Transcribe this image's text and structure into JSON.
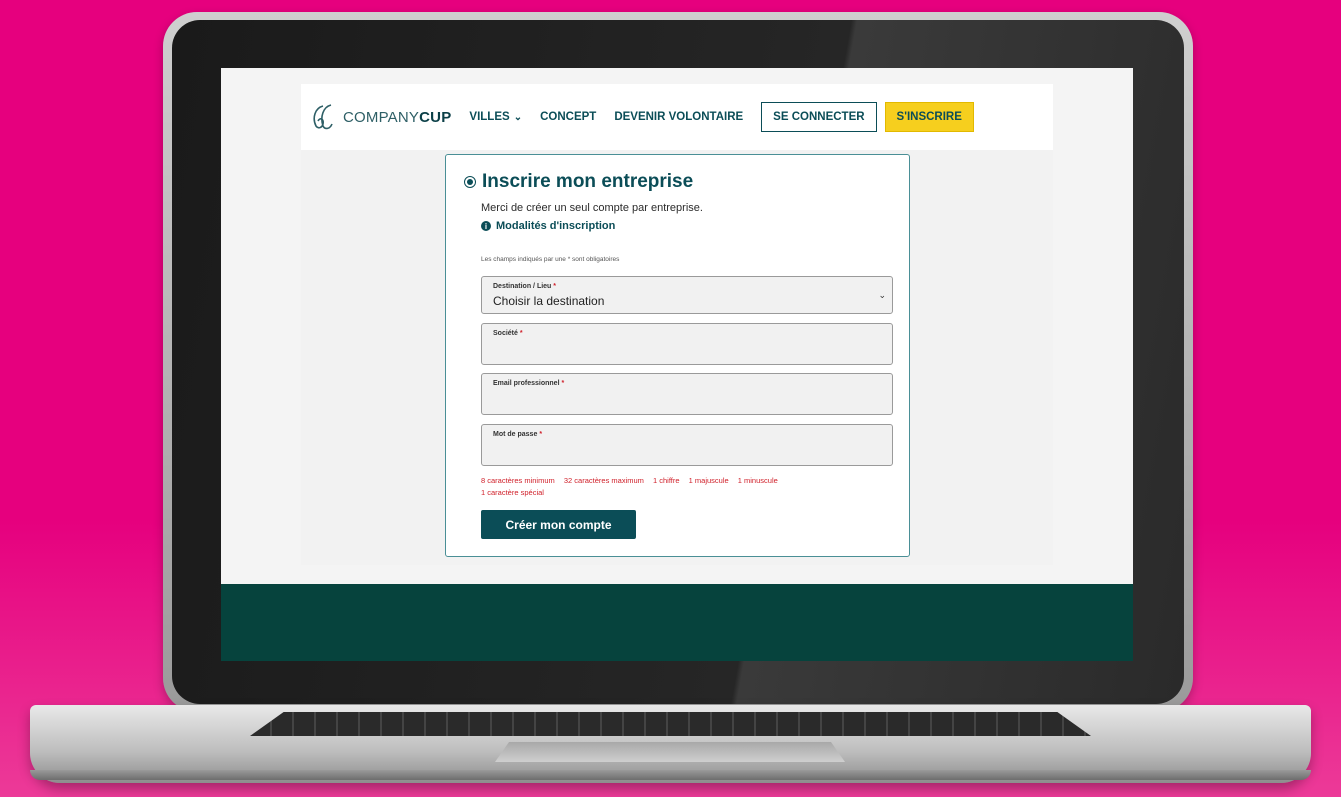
{
  "header": {
    "logo_text_light": "COMPANY",
    "logo_text_bold": "CUP",
    "nav_villes": "VILLES",
    "nav_concept": "CONCEPT",
    "nav_volontaire": "DEVENIR VOLONTAIRE",
    "login_label": "SE CONNECTER",
    "register_label": "S'INSCRIRE"
  },
  "form": {
    "title": "Inscrire mon entreprise",
    "intro": "Merci de créer un seul compte par entreprise.",
    "modalites": "Modalités d'inscription",
    "required_note": "Les champs indiqués par une * sont obligatoires",
    "destination_label": "Destination / Lieu",
    "destination_value": "Choisir la destination",
    "societe_label": "Société",
    "email_label": "Email professionnel",
    "password_label": "Mot de passe",
    "required_mark": "*",
    "password_rules": [
      "8 caractères minimum",
      "32 caractères maximum",
      "1 chiffre",
      "1 majuscule",
      "1 minuscule",
      "1 caractère spécial"
    ],
    "submit_label": "Créer mon compte"
  },
  "colors": {
    "page_background": "#e6007e",
    "brand_teal": "#0b4d57",
    "accent_yellow": "#f6cf1e",
    "footer": "#06433d",
    "required_red": "#d0202a"
  }
}
